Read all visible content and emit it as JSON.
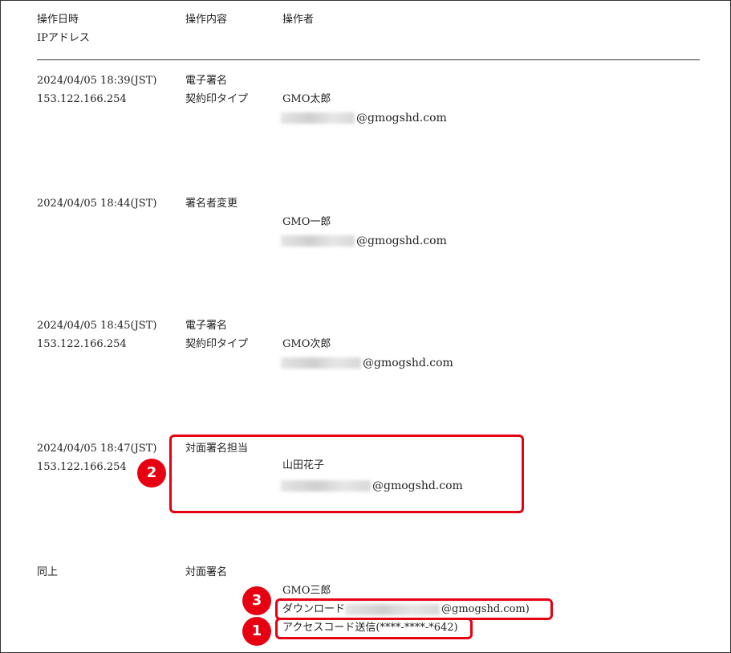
{
  "headers": {
    "datetime": "操作日時",
    "ip": "IPアドレス",
    "content": "操作内容",
    "operator": "操作者"
  },
  "logs": [
    {
      "datetime": "2024/04/05 18:39(JST)",
      "ip": "153.122.166.254",
      "content1": "電子署名",
      "content2": "契約印タイプ",
      "operator_name": "GMO太郎",
      "email_domain": "@gmogshd.com"
    },
    {
      "datetime": "2024/04/05 18:44(JST)",
      "content1": "署名者変更",
      "operator_name": "GMO一郎",
      "email_domain": "@gmogshd.com"
    },
    {
      "datetime": "2024/04/05 18:45(JST)",
      "ip": "153.122.166.254",
      "content1": "電子署名",
      "content2": "契約印タイプ",
      "operator_name": "GMO次郎",
      "email_domain": "@gmogshd.com"
    },
    {
      "datetime": "2024/04/05 18:47(JST)",
      "ip": "153.122.166.254",
      "content1": "対面署名担当",
      "operator_name": "山田花子",
      "email_domain": "@gmogshd.com"
    },
    {
      "datetime": "同上",
      "content1": "対面署名",
      "operator_name": "GMO三郎",
      "download_prefix": "ダウンロード",
      "download_suffix": "@gmogshd.com)",
      "access_code": "アクセスコード送信(****-****-*642)"
    }
  ],
  "badges": [
    "2",
    "3",
    "1"
  ],
  "colors": {
    "highlight": "#e60012",
    "badge": "#e60012"
  }
}
